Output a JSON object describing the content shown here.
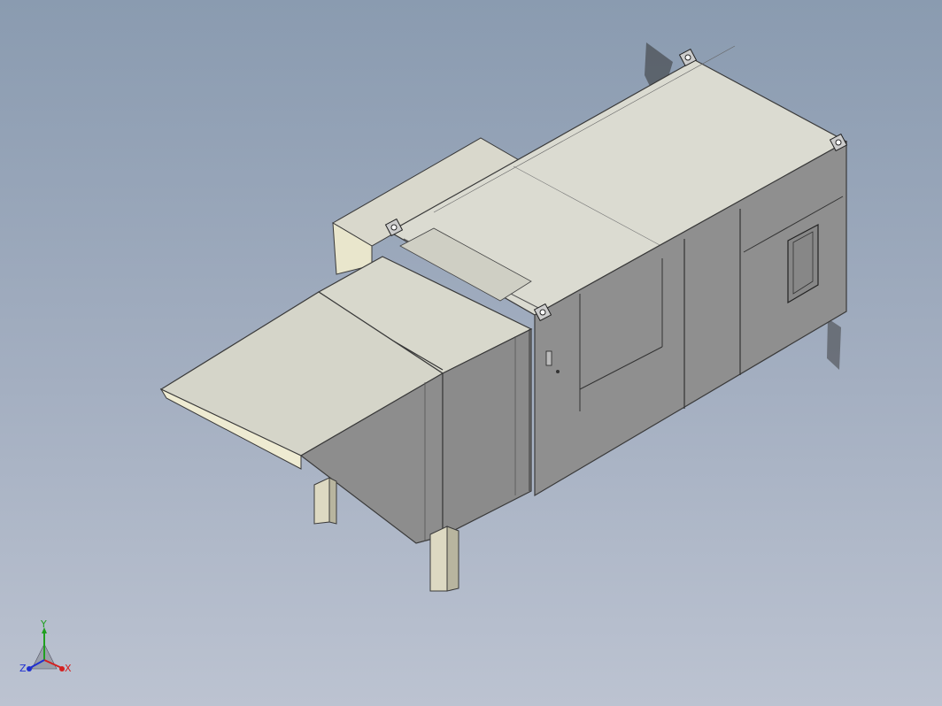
{
  "viewport": {
    "background_top": "#8a9bb0",
    "background_bottom": "#bcc3d1"
  },
  "model": {
    "body_color": "#d8d8cc",
    "side_color": "#8f8f8f",
    "edge_color": "#3a3a3a",
    "cream_color": "#eeebd2"
  },
  "triad": {
    "x_label": "X",
    "y_label": "Y",
    "z_label": "Z",
    "x_color": "#d42020",
    "y_color": "#20a020",
    "z_color": "#2030d0"
  }
}
